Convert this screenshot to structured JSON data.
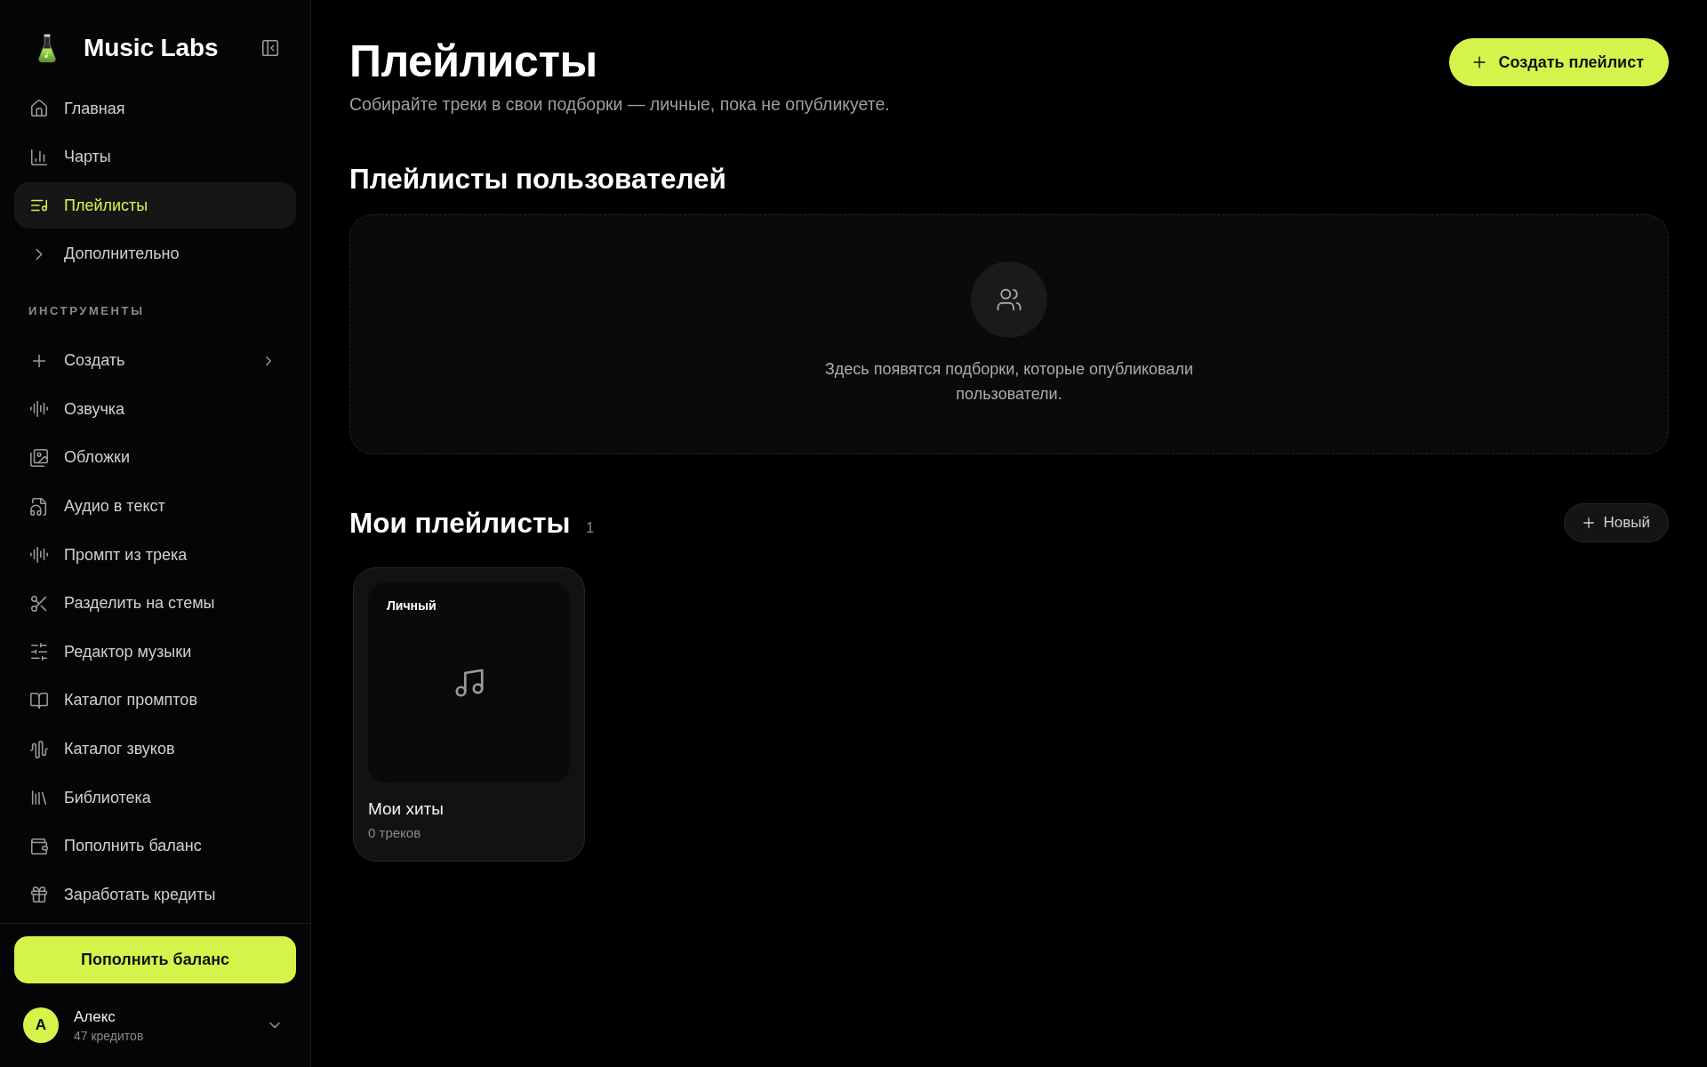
{
  "sidebar": {
    "logo": {
      "title": "Music Labs"
    },
    "nav": [
      {
        "label": "Главная",
        "selected": false
      },
      {
        "label": "Чарты",
        "selected": false
      },
      {
        "label": "Плейлисты",
        "selected": true
      },
      {
        "label": "Дополнительно",
        "selected": false
      }
    ],
    "tools": {
      "heading": "ИНСТРУМЕНТЫ",
      "items": [
        {
          "label": "Создать",
          "kind": "submenu"
        },
        {
          "label": "Озвучка",
          "kind": "link"
        },
        {
          "label": "Обложки",
          "kind": "link"
        },
        {
          "label": "Аудио в текст",
          "kind": "link"
        },
        {
          "label": "Промпт из трека",
          "kind": "link"
        },
        {
          "label": "Разделить на стемы",
          "kind": "link"
        },
        {
          "label": "Редактор музыки",
          "kind": "link"
        },
        {
          "label": "Каталог промптов",
          "kind": "link"
        },
        {
          "label": "Каталог звуков",
          "kind": "link"
        },
        {
          "label": "Библиотека",
          "kind": "link"
        },
        {
          "label": "Пополнить баланс",
          "kind": "link"
        },
        {
          "label": "Заработать кредиты",
          "kind": "link"
        }
      ]
    },
    "topup_button": "Пополнить баланс",
    "user": {
      "initial": "А",
      "name": "Алекс",
      "credits": "47 кредитов"
    }
  },
  "header": {
    "title": "Плейлисты",
    "subtitle": "Собирайте треки в свои подборки — личные, пока не опубликуете.",
    "create_button": "Создать плейлист"
  },
  "community": {
    "heading": "Плейлисты пользователей",
    "empty_text": "Здесь появятся подборки, которые опубликовали пользователи."
  },
  "my_playlists": {
    "heading": "Мои плейлисты",
    "count": "1",
    "new_button": "Новый",
    "items": [
      {
        "badge": "Личный",
        "title": "Мои хиты",
        "tracks": "0 треков"
      }
    ]
  }
}
